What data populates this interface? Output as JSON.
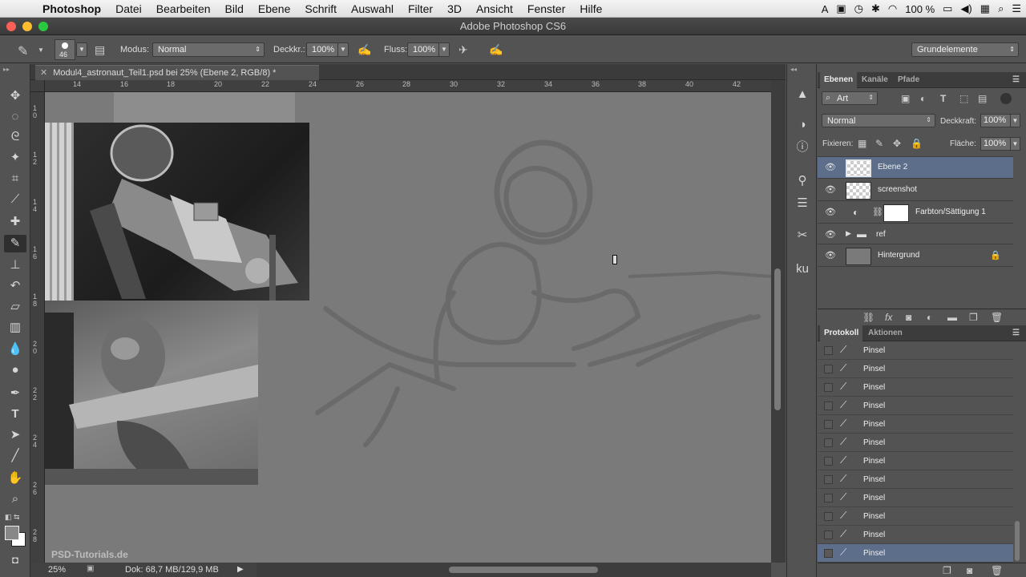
{
  "menubar": {
    "app": "Photoshop",
    "items": [
      "Datei",
      "Bearbeiten",
      "Bild",
      "Ebene",
      "Schrift",
      "Auswahl",
      "Filter",
      "3D",
      "Ansicht",
      "Fenster",
      "Hilfe"
    ],
    "battery": "100 %"
  },
  "window": {
    "title": "Adobe Photoshop CS6"
  },
  "options": {
    "brush_size": "46",
    "mode_label": "Modus:",
    "mode_value": "Normal",
    "opacity_label": "Deckkr.:",
    "opacity_value": "100%",
    "flow_label": "Fluss:",
    "flow_value": "100%",
    "workspace": "Grundelemente"
  },
  "document": {
    "tab_title": "Modul4_astronaut_Teil1.psd bei 25% (Ebene 2, RGB/8) *",
    "ruler_h": [
      "14",
      "16",
      "18",
      "20",
      "22",
      "24",
      "26",
      "28",
      "30",
      "32",
      "34",
      "36",
      "38",
      "40",
      "42"
    ],
    "ruler_v": [
      "10",
      "12",
      "14",
      "16",
      "18",
      "20",
      "22",
      "24",
      "26",
      "28"
    ]
  },
  "status": {
    "zoom": "25%",
    "doc_info": "Dok: 68,7 MB/129,9 MB",
    "watermark": "PSD-Tutorials.de"
  },
  "layers_panel": {
    "tabs": [
      "Ebenen",
      "Kanäle",
      "Pfade"
    ],
    "filter_kind": "Art",
    "blend_mode": "Normal",
    "opacity_label": "Deckkraft:",
    "opacity_value": "100%",
    "lock_label": "Fixieren:",
    "fill_label": "Fläche:",
    "fill_value": "100%",
    "layers": [
      {
        "name": "Ebene 2"
      },
      {
        "name": "screenshot"
      },
      {
        "name": "Farbton/Sättigung 1"
      },
      {
        "name": "ref"
      },
      {
        "name": "Hintergrund"
      }
    ]
  },
  "history_panel": {
    "tabs": [
      "Protokoll",
      "Aktionen"
    ],
    "items": [
      "Pinsel",
      "Pinsel",
      "Pinsel",
      "Pinsel",
      "Pinsel",
      "Pinsel",
      "Pinsel",
      "Pinsel",
      "Pinsel",
      "Pinsel",
      "Pinsel",
      "Pinsel"
    ]
  },
  "colors": {
    "selection": "#5c6e8a",
    "canvas": "#7a7a7a",
    "panel": "#535353"
  }
}
